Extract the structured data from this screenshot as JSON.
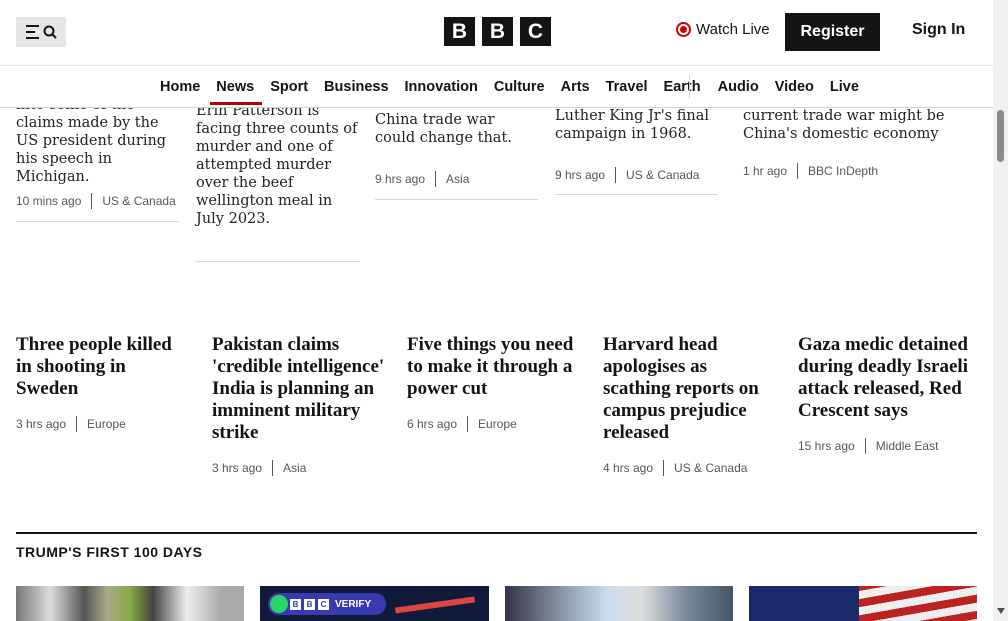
{
  "header": {
    "logo_letters": [
      "B",
      "B",
      "C"
    ],
    "watch_live": "Watch Live",
    "register": "Register",
    "sign_in": "Sign In"
  },
  "nav": {
    "items": [
      "Home",
      "News",
      "Sport",
      "Business",
      "Innovation",
      "Culture",
      "Arts",
      "Travel",
      "Earth",
      "Audio",
      "Video",
      "Live"
    ],
    "active": "News"
  },
  "top_stories": [
    {
      "summary": "into some of the claims made by the US president during his speech in Michigan.",
      "time": "10 mins ago",
      "section": "US & Canada"
    },
    {
      "summary": "Erin Patterson is facing three counts of murder and one of attempted murder over the beef wellington meal in July 2023.",
      "time": "",
      "section": ""
    },
    {
      "summary": "China trade war could change that.",
      "time": "9 hrs ago",
      "section": "Asia"
    },
    {
      "summary": "Luther King Jr's final campaign in 1968.",
      "time": "9 hrs ago",
      "section": "US & Canada"
    },
    {
      "summary": "current trade war might be China's domestic economy",
      "time": "1 hr ago",
      "section": "BBC InDepth"
    }
  ],
  "cards": [
    {
      "headline": "Three people killed in shooting in Sweden",
      "time": "3 hrs ago",
      "section": "Europe"
    },
    {
      "headline": "Pakistan claims 'credible intelligence' India is planning an imminent military strike",
      "time": "3 hrs ago",
      "section": "Asia"
    },
    {
      "headline": "Five things you need to make it through a power cut",
      "time": "6 hrs ago",
      "section": "Europe"
    },
    {
      "headline": "Harvard head apologises as scathing reports on campus prejudice released",
      "time": "4 hrs ago",
      "section": "US & Canada"
    },
    {
      "headline": "Gaza medic detained during deadly Israeli attack released, Red Crescent says",
      "time": "15 hrs ago",
      "section": "Middle East"
    }
  ],
  "section": {
    "title": "TRUMP'S FIRST 100 DAYS"
  },
  "verify_badge": {
    "letters": [
      "B",
      "B",
      "C"
    ],
    "text": "VERIFY"
  }
}
